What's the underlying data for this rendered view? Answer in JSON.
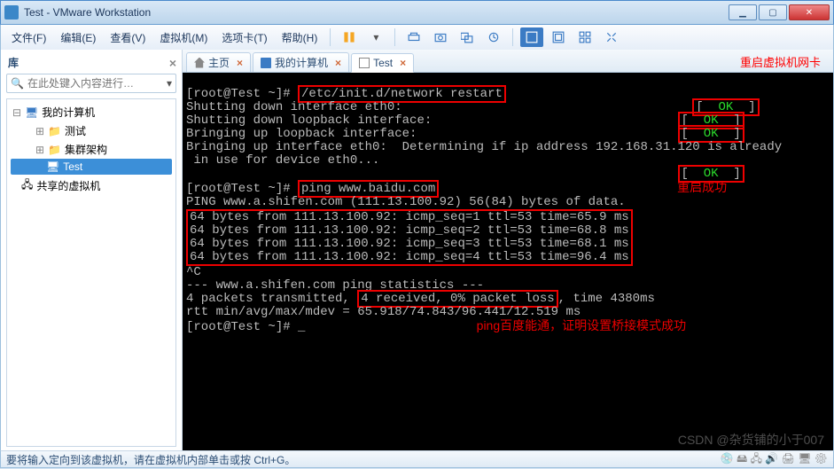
{
  "window": {
    "title": "Test - VMware Workstation",
    "min": "▁",
    "max": "▢",
    "close": "✕"
  },
  "menu": {
    "file": "文件(F)",
    "edit": "编辑(E)",
    "view": "查看(V)",
    "vm": "虚拟机(M)",
    "tabs": "选项卡(T)",
    "help": "帮助(H)"
  },
  "sidebar": {
    "title": "库",
    "close_x": "×",
    "search_placeholder": "在此处键入内容进行…",
    "dropdown": "▾",
    "root": "我的计算机",
    "nodes": {
      "n1": "测试",
      "n2": "集群架构",
      "n3": "Test"
    },
    "shared": "共享的虚拟机"
  },
  "tabs": {
    "home": "主页",
    "my": "我的计算机",
    "test": "Test",
    "close": "×"
  },
  "annotations": {
    "restart": "重启虚拟机网卡",
    "success": "重启成功",
    "pingok": "ping百度能通，证明设置桥接模式成功"
  },
  "terminal": {
    "prompt1": "[root@Test ~]# ",
    "cmd1": "/etc/init.d/network restart",
    "l2": "Shutting down interface eth0:",
    "l3": "Shutting down loopback interface:",
    "l4": "Bringing up loopback interface:",
    "l5a": "Bringing up interface eth0:  Determining if ip address 192",
    "l5b": "168.31.120 is already",
    "l6": " in use for device eth0...",
    "blank": "",
    "prompt2": "[root@Test ~]# ",
    "cmd2": "ping www.baidu.com",
    "pinghdr": "PING www.a.shifen.com (111.13.100.92) 56(84) bytes of data.",
    "r1": "64 bytes from 111.13.100.92: icmp_seq=1 ttl=53 time=65.9 ms",
    "r2": "64 bytes from 111.13.100.92: icmp_seq=2 ttl=53 time=68.8 ms",
    "r3": "64 bytes from 111.13.100.92: icmp_seq=3 ttl=53 time=68.1 ms",
    "r4": "64 bytes from 111.13.100.92: icmp_seq=4 ttl=53 time=96.4 ms",
    "ctrlc": "^C",
    "stats1": "--- www.a.shifen.com ping statistics ---",
    "stats2a": "4 packets transmitted, ",
    "stats2b": "4 received, 0% packet loss",
    "stats2c": ", time 4380ms",
    "stats3": "rtt min/avg/max/mdev = 65.918/74.843/96.441/12.519 ms",
    "prompt3": "[root@Test ~]# _",
    "ok_open": "[  ",
    "ok": "OK",
    "ok_close": "  ]"
  },
  "status": {
    "text": "要将输入定向到该虚拟机，请在虚拟机内部单击或按 Ctrl+G。",
    "watermark": "CSDN @杂货铺的小于007"
  }
}
